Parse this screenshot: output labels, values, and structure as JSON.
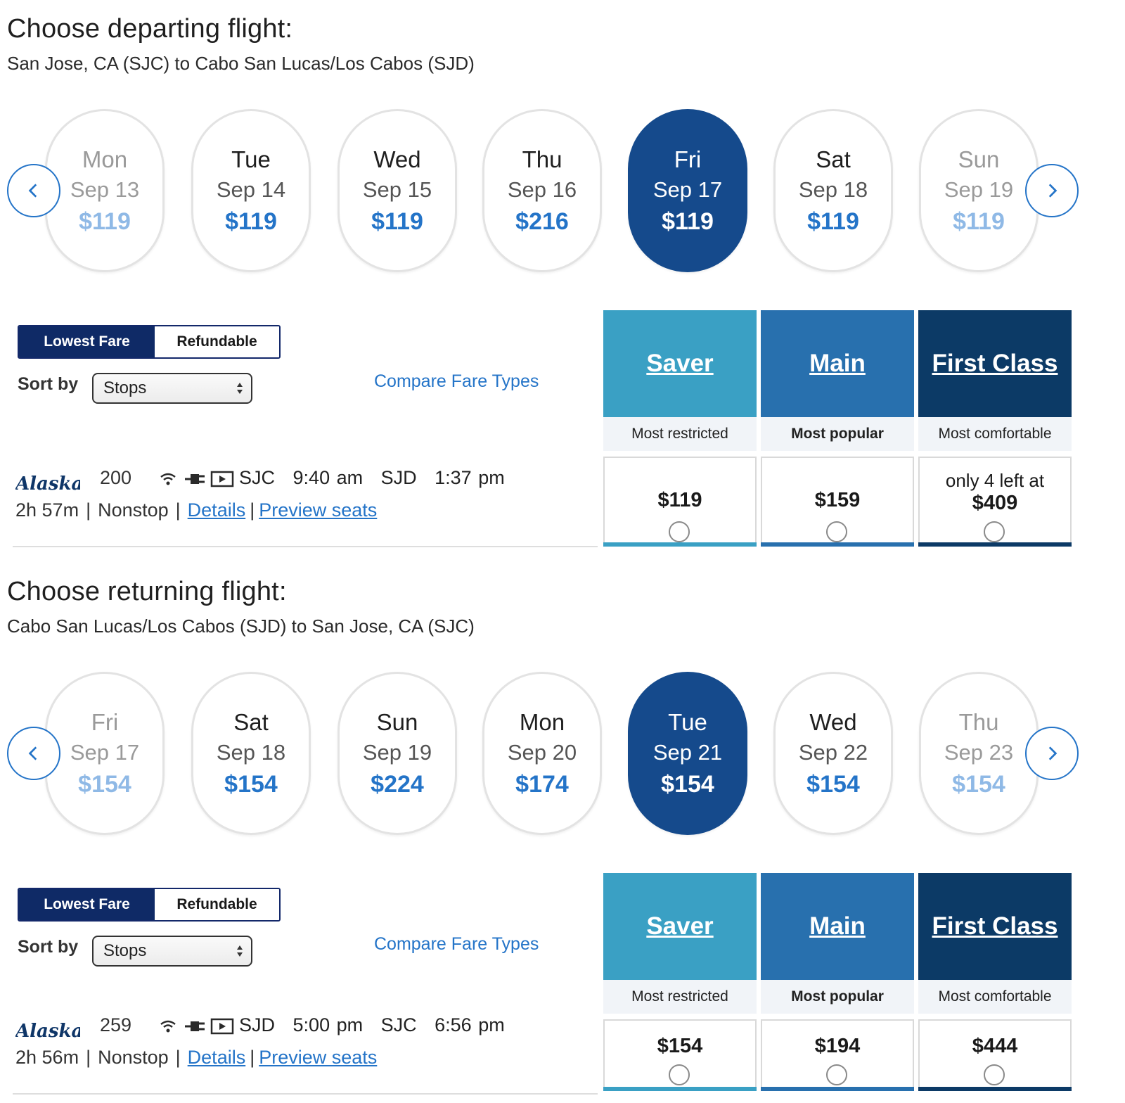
{
  "depart": {
    "heading": "Choose departing flight:",
    "route": "San Jose, CA (SJC) to Cabo San Lucas/Los Cabos (SJD)",
    "days": [
      {
        "day": "Mon",
        "date": "Sep 13",
        "price": "$119"
      },
      {
        "day": "Tue",
        "date": "Sep 14",
        "price": "$119"
      },
      {
        "day": "Wed",
        "date": "Sep 15",
        "price": "$119"
      },
      {
        "day": "Thu",
        "date": "Sep 16",
        "price": "$216"
      },
      {
        "day": "Fri",
        "date": "Sep 17",
        "price": "$119"
      },
      {
        "day": "Sat",
        "date": "Sep 18",
        "price": "$119"
      },
      {
        "day": "Sun",
        "date": "Sep 19",
        "price": "$119"
      }
    ],
    "toggle": {
      "lowest": "Lowest Fare",
      "refundable": "Refundable"
    },
    "sort_label": "Sort by",
    "sort_value": "Stops",
    "compare": "Compare Fare Types",
    "fares": {
      "saver": {
        "title": "Saver",
        "desc": "Most restricted",
        "price": "$119"
      },
      "main": {
        "title": "Main",
        "desc": "Most popular",
        "price": "$159"
      },
      "first": {
        "title": "First Class",
        "desc": "Most comfortable",
        "note": "only 4 left at",
        "price": "$409"
      }
    },
    "flight": {
      "number": "200",
      "from": "SJC",
      "depart_time": "9:40 am",
      "to": "SJD",
      "arrive_time": "1:37 pm",
      "duration": "2h 57m",
      "stops": "Nonstop",
      "details": "Details",
      "preview": "Preview seats"
    }
  },
  "return": {
    "heading": "Choose returning flight:",
    "route": "Cabo San Lucas/Los Cabos (SJD) to San Jose, CA (SJC)",
    "days": [
      {
        "day": "Fri",
        "date": "Sep 17",
        "price": "$154"
      },
      {
        "day": "Sat",
        "date": "Sep 18",
        "price": "$154"
      },
      {
        "day": "Sun",
        "date": "Sep 19",
        "price": "$224"
      },
      {
        "day": "Mon",
        "date": "Sep 20",
        "price": "$174"
      },
      {
        "day": "Tue",
        "date": "Sep 21",
        "price": "$154"
      },
      {
        "day": "Wed",
        "date": "Sep 22",
        "price": "$154"
      },
      {
        "day": "Thu",
        "date": "Sep 23",
        "price": "$154"
      }
    ],
    "toggle": {
      "lowest": "Lowest Fare",
      "refundable": "Refundable"
    },
    "sort_label": "Sort by",
    "sort_value": "Stops",
    "compare": "Compare Fare Types",
    "fares": {
      "saver": {
        "title": "Saver",
        "desc": "Most restricted",
        "price": "$154"
      },
      "main": {
        "title": "Main",
        "desc": "Most popular",
        "price": "$194"
      },
      "first": {
        "title": "First Class",
        "desc": "Most comfortable",
        "price": "$444"
      }
    },
    "flight": {
      "number": "259",
      "from": "SJD",
      "depart_time": "5:00 pm",
      "to": "SJC",
      "arrive_time": "6:56 pm",
      "duration": "2h 56m",
      "stops": "Nonstop",
      "details": "Details",
      "preview": "Preview seats"
    }
  },
  "airline_logo_text": "Alaska",
  "colors": {
    "accent_blue": "#2474c8",
    "selected_day": "#154a8c",
    "saver": "#3aa0c4",
    "main": "#2870ae",
    "first": "#0c3a66",
    "toggle_active": "#0f2a66"
  },
  "icons": [
    "chevron-left-icon",
    "chevron-right-icon",
    "wifi-icon",
    "power-plug-icon",
    "entertainment-screen-icon"
  ]
}
